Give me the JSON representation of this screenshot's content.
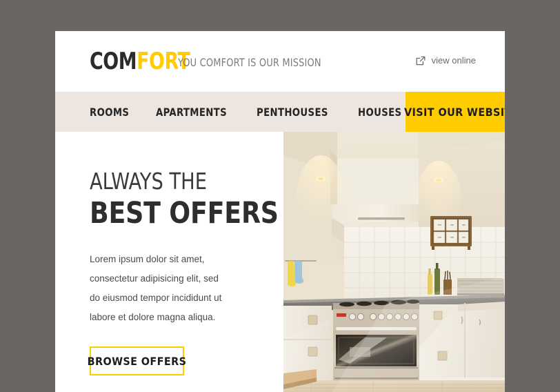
{
  "header": {
    "logo_part1": "COM",
    "logo_part2": "FORT",
    "tagline": "YOU COMFORT IS OUR MISSION",
    "view_online_label": "view online",
    "view_online_icon": "external-link-icon"
  },
  "nav": {
    "items": [
      {
        "label": "ROOMS"
      },
      {
        "label": "APARTMENTS"
      },
      {
        "label": "PENTHOUSES"
      },
      {
        "label": "HOUSES"
      }
    ],
    "cta_label": "VISIT OUR WEBSITE"
  },
  "hero": {
    "headline_small": "ALWAYS THE",
    "headline_large": "BEST OFFERS",
    "body": "Lorem ipsum dolor sit amet, consectetur adipisicing elit, sed do eiusmod tempor incididunt ut labore et dolore magna aliqua.",
    "button_label": "BROWSE OFFERS",
    "photo_alt": "modern kitchen interior with stainless steel range cooker"
  },
  "colors": {
    "page_background": "#6b6663",
    "card_background": "#ffffff",
    "accent_yellow": "#ffcc00",
    "nav_background": "#ece5e0",
    "heading_text": "#2e2e2e",
    "body_text": "#4a4a4a",
    "muted_text": "#7d7a78"
  }
}
